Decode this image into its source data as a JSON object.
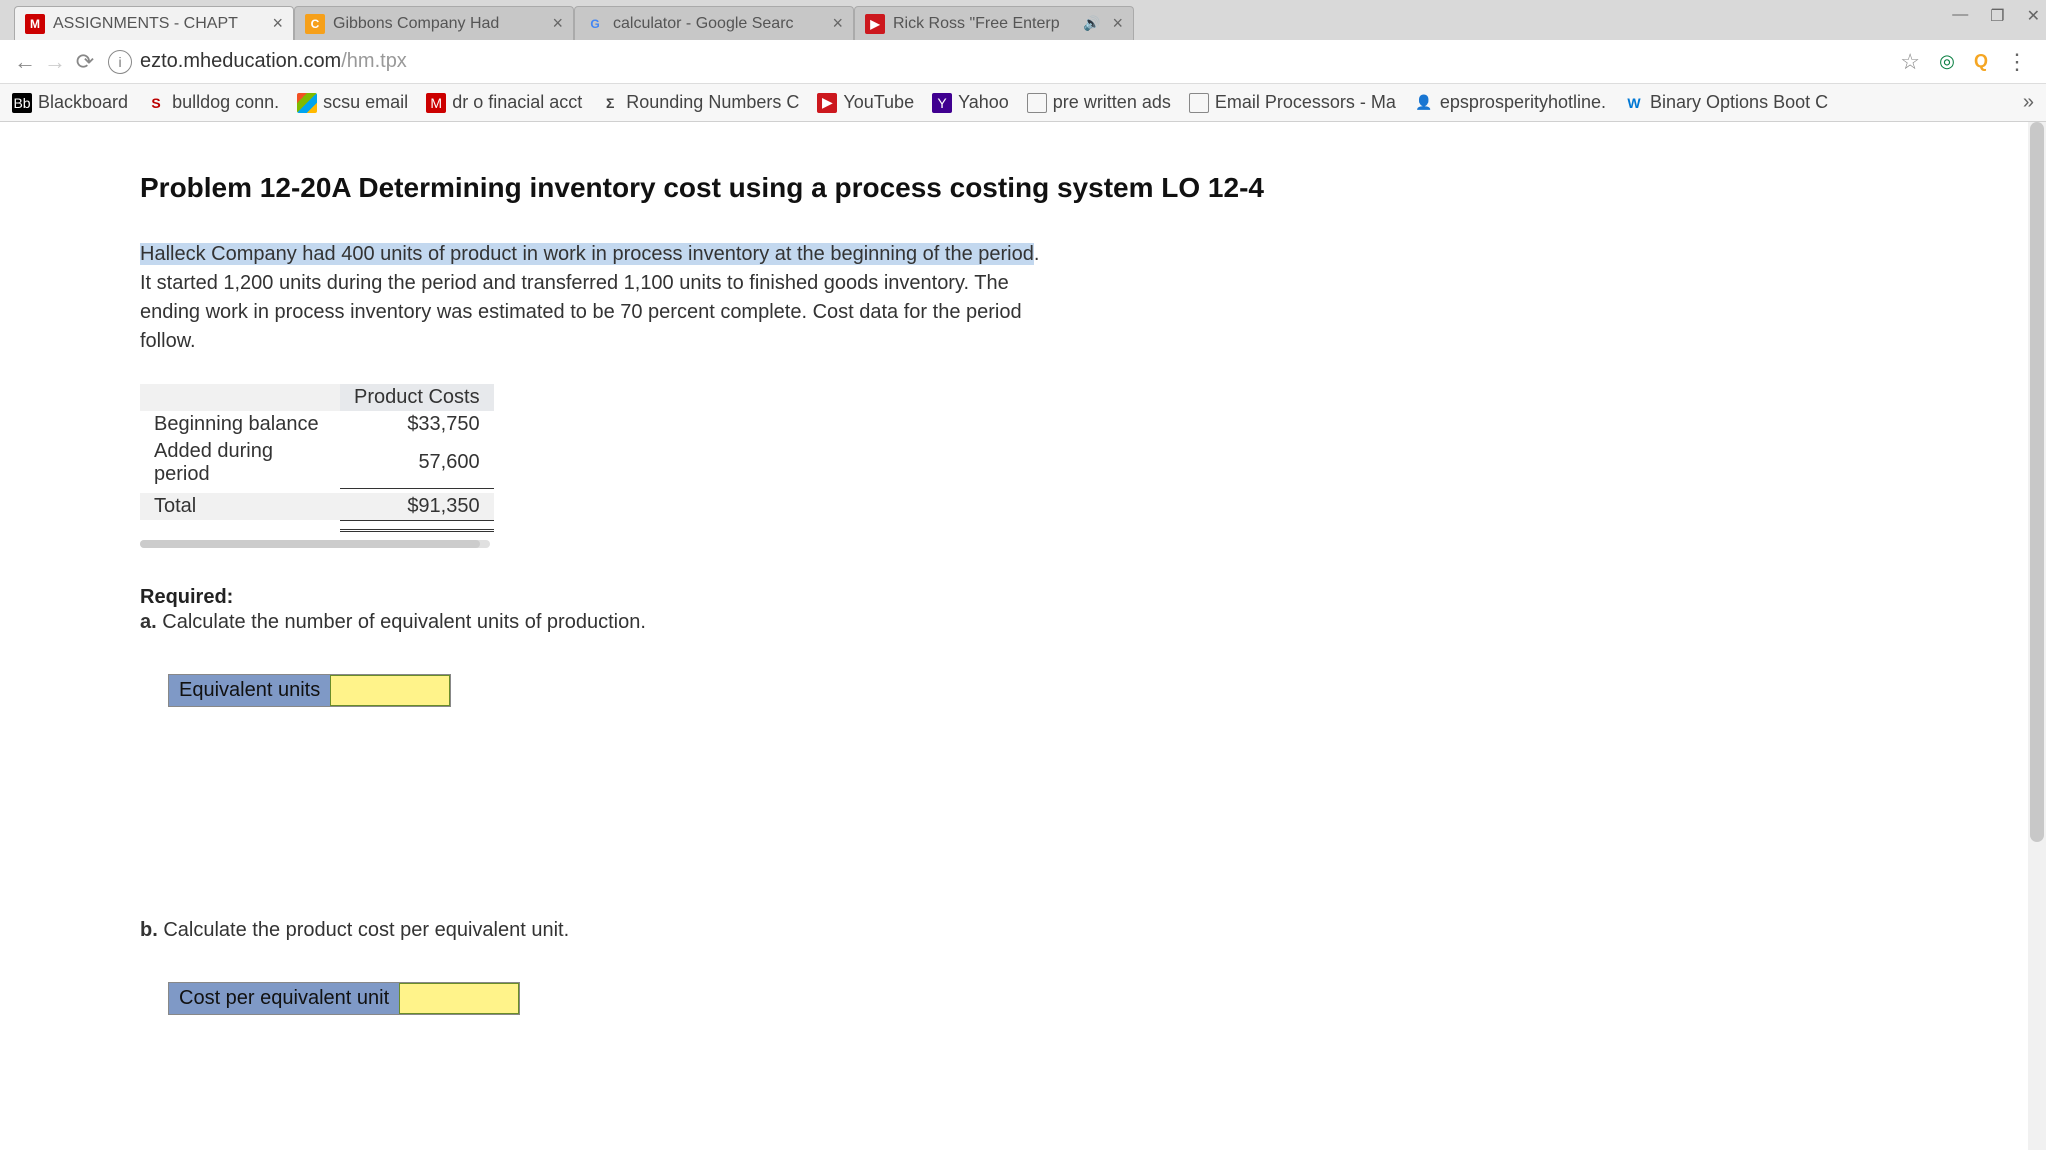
{
  "tabs": [
    {
      "title": "ASSIGNORMENTS - CHAPT",
      "short": "ASSIGNMENTS - CHAPT",
      "faviconLetter": "M",
      "active": true
    },
    {
      "title": "Gibbons Company Had",
      "faviconLetter": "C"
    },
    {
      "title": "calculator - Google Searc",
      "faviconLetter": "G"
    },
    {
      "title": "Rick Ross \"Free Enterp",
      "faviconLetter": "▶",
      "sound": true
    }
  ],
  "url": {
    "prefix": "ezto.mheducation.com",
    "path": "/hm.tpx"
  },
  "bookmarks": [
    {
      "label": "Blackboard",
      "iconCls": "fi-bb",
      "iconTxt": "Bb"
    },
    {
      "label": "bulldog conn.",
      "iconCls": "fi-s",
      "iconTxt": "S"
    },
    {
      "label": "scsu email",
      "iconCls": "fi-ms",
      "iconTxt": ""
    },
    {
      "label": "dr o finacial acct",
      "iconCls": "fi-m",
      "iconTxt": "M"
    },
    {
      "label": "Rounding Numbers C",
      "iconCls": "fi-sigma",
      "iconTxt": "Σ"
    },
    {
      "label": "YouTube",
      "iconCls": "fi-yt",
      "iconTxt": "▶"
    },
    {
      "label": "Yahoo",
      "iconCls": "fi-y",
      "iconTxt": "Y"
    },
    {
      "label": "pre written ads",
      "iconCls": "fi-doc",
      "iconTxt": ""
    },
    {
      "label": "Email Processors - Ma",
      "iconCls": "fi-doc",
      "iconTxt": ""
    },
    {
      "label": "epsprosperityhotline.",
      "iconCls": "fi-person",
      "iconTxt": "👤"
    },
    {
      "label": "Binary Options Boot C",
      "iconCls": "fi-w",
      "iconTxt": "W"
    }
  ],
  "problem": {
    "title": "Problem 12-20A Determining inventory cost using a process costing system LO 12-4",
    "text_hl": "Halleck Company had 400 units of product in work in process inventory at the beginning of the period",
    "text_rest": ". It started 1,200 units during the period and transferred 1,100 units to finished goods inventory. The ending work in process inventory was estimated to be 70 percent complete. Cost data for the period follow."
  },
  "cost_table": {
    "header": "Product Costs",
    "rows": [
      {
        "label": "Beginning balance",
        "amount": "$33,750"
      },
      {
        "label": "Added during period",
        "amount": "57,600"
      }
    ],
    "total_label": "Total",
    "total_amount": "$91,350"
  },
  "required": {
    "header": "Required:",
    "a": "Calculate the number of equivalent units of production.",
    "b": "Calculate the product cost per equivalent unit.",
    "box_a_label": "Equivalent units",
    "box_b_label": "Cost per equivalent unit"
  }
}
